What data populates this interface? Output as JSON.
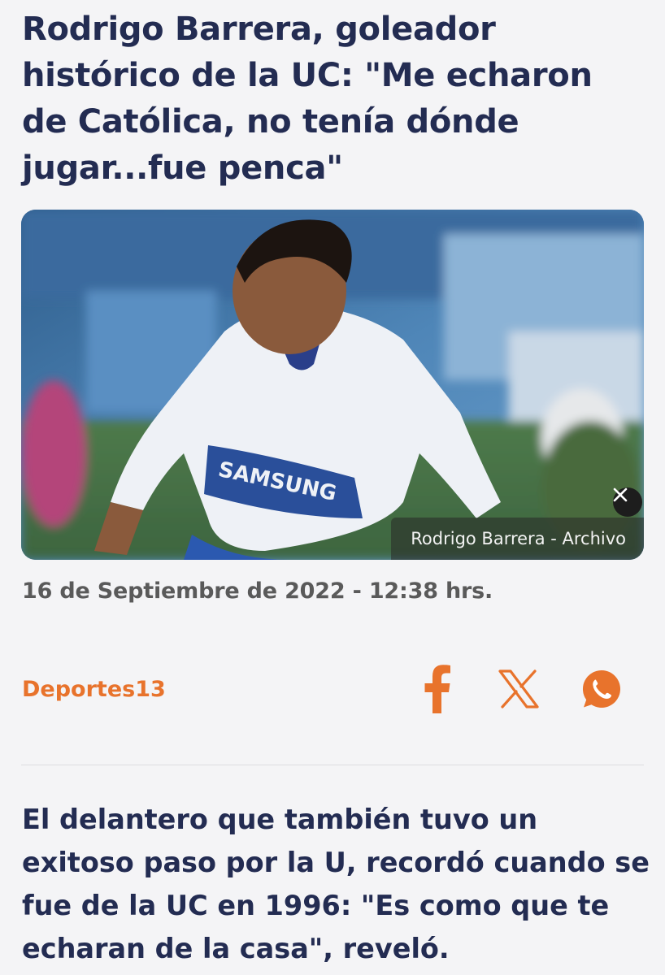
{
  "article": {
    "headline": "Rodrigo Barrera, goleador histórico de la UC: \"Me echaron de Católica, no tenía dónde jugar...fue penca\"",
    "image": {
      "caption": "Rodrigo Barrera - Archivo",
      "jersey_text": "SAMSUNG",
      "close_icon": "close-icon"
    },
    "date": "16 de Septiembre de 2022 - 12:38 hrs.",
    "source": "Deportes13",
    "share": {
      "icons": [
        "facebook-icon",
        "x-icon",
        "whatsapp-icon"
      ],
      "color": "#e8732c"
    },
    "lead": "El delantero que también tuvo un exitoso paso por la U, recordó cuando se fue de la UC en 1996: \"Es como que te echaran de la casa\", reveló."
  },
  "colors": {
    "headline": "#232c52",
    "accent": "#e8732c",
    "date": "#5a5a5a",
    "background": "#f4f4f6"
  }
}
